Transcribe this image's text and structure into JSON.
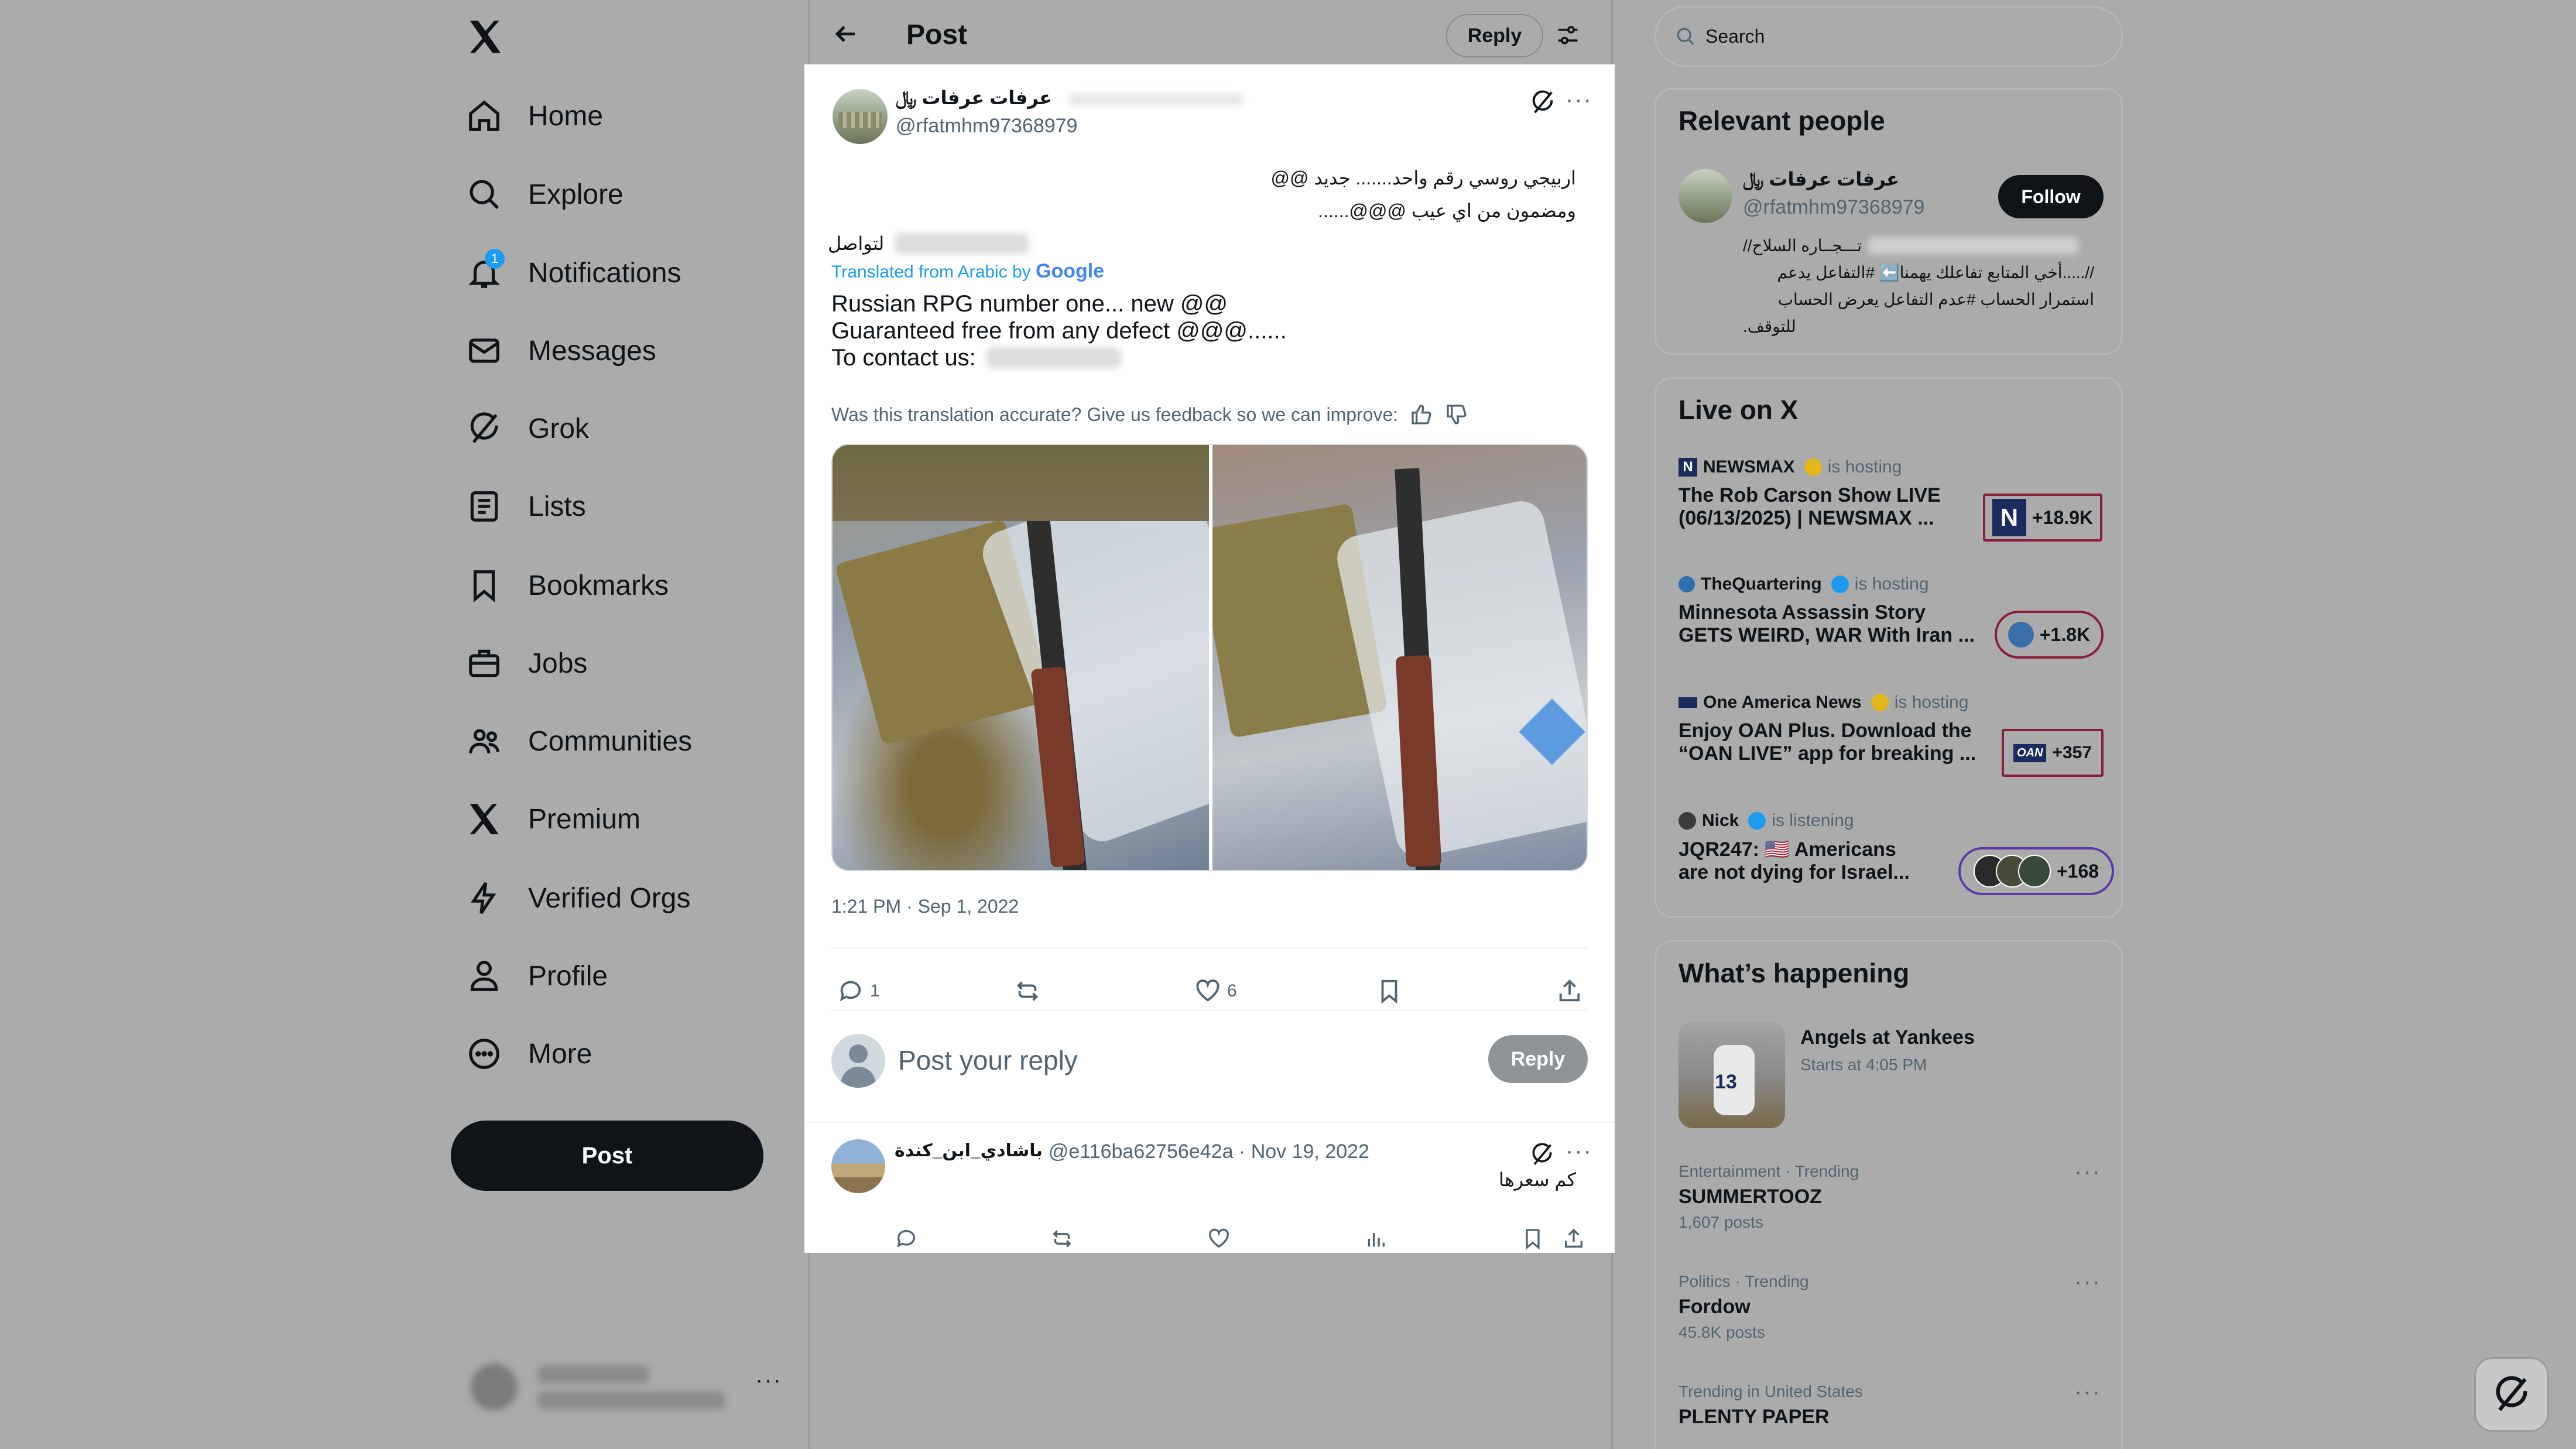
{
  "nav": {
    "items": [
      {
        "label": "Home",
        "icon": "home-icon"
      },
      {
        "label": "Explore",
        "icon": "search-icon"
      },
      {
        "label": "Notifications",
        "icon": "bell-icon"
      },
      {
        "label": "Messages",
        "icon": "envelope-icon"
      },
      {
        "label": "Grok",
        "icon": "grok-icon"
      },
      {
        "label": "Lists",
        "icon": "list-icon"
      },
      {
        "label": "Bookmarks",
        "icon": "bookmark-icon"
      },
      {
        "label": "Jobs",
        "icon": "briefcase-icon"
      },
      {
        "label": "Communities",
        "icon": "people-icon"
      },
      {
        "label": "Premium",
        "icon": "x-logo-icon"
      },
      {
        "label": "Verified Orgs",
        "icon": "lightning-icon"
      },
      {
        "label": "Profile",
        "icon": "person-icon"
      },
      {
        "label": "More",
        "icon": "more-circle-icon"
      }
    ],
    "notification_count": "1",
    "post_button": "Post",
    "account_more": "···"
  },
  "header": {
    "title": "Post",
    "reply_button": "Reply"
  },
  "post": {
    "author_name": "عرفات عرفات ﷼",
    "author_handle": "@rfatmhm97368979",
    "arabic_lines": [
      "اربيجي روسي رقم واحد....... جديد @@",
      "ومضمون من اي عيب @@@......",
      "لتواصل"
    ],
    "translated_prefix": "Translated from Arabic by",
    "translated_by": "Google",
    "translation_lines": [
      "Russian RPG number one... new @@",
      "Guaranteed free from any defect @@@......",
      "To contact us:"
    ],
    "feedback_question": "Was this translation accurate? Give us feedback so we can improve:",
    "timestamp": "1:21 PM · Sep 1, 2022",
    "replies": "1",
    "likes": "6"
  },
  "reply_box": {
    "placeholder": "Post your reply",
    "button": "Reply"
  },
  "reply": {
    "author_name": "باشادي_ابن_كندة",
    "meta": "@e116ba62756e42a · Nov 19, 2022",
    "text": "كم سعرها"
  },
  "search": {
    "placeholder": "Search"
  },
  "relevant": {
    "title": "Relevant people",
    "name": "عرفات عرفات ﷼",
    "handle": "@rfatmhm97368979",
    "follow": "Follow",
    "bio_lines": [
      "تـــجــاره السلاح//",
      "//.....أخي المتابع تفاعلك يهمنا⬅️ #التفاعل يدعم",
      "استمرار الحساب #عدم التفاعل يعرض الحساب",
      "للتوقف."
    ]
  },
  "live": {
    "title": "Live on X",
    "items": [
      {
        "host": "NEWSMAX",
        "status": "is hosting",
        "title1": "The Rob Carson Show LIVE",
        "title2": "(06/13/2025) | NEWSMAX ...",
        "count": "+18.9K"
      },
      {
        "host": "TheQuartering",
        "status": "is hosting",
        "title1": "Minnesota Assassin Story",
        "title2": "GETS WEIRD, WAR With Iran ...",
        "count": "+1.8K"
      },
      {
        "host": "One America News",
        "status": "is hosting",
        "title1": "Enjoy OAN Plus. Download the",
        "title2": "“OAN LIVE” app for breaking ...",
        "count": "+357",
        "logo": "OAN"
      },
      {
        "host": "Nick",
        "status": "is listening",
        "title1": "JQR247: 🇺🇸 Americans",
        "title2": "are not dying for Israel...",
        "count": "+168"
      }
    ]
  },
  "happening": {
    "title": "What’s happening",
    "event_title": "Angels at Yankees",
    "event_time": "Starts at 4:05 PM",
    "event_jersey": "13",
    "trends": [
      {
        "context": "Entertainment · Trending",
        "name": "SUMMERTOOZ",
        "posts": "1,607 posts"
      },
      {
        "context": "Politics · Trending",
        "name": "Fordow",
        "posts": "45.8K posts"
      },
      {
        "context": "Trending in United States",
        "name": "PLENTY PAPER",
        "posts": ""
      }
    ]
  },
  "colors": {
    "accent": "#1d9bf0",
    "dark": "#0f1419",
    "muted": "#536471",
    "live_border": "#8b1c3a",
    "verified_gold": "#e2b719"
  }
}
